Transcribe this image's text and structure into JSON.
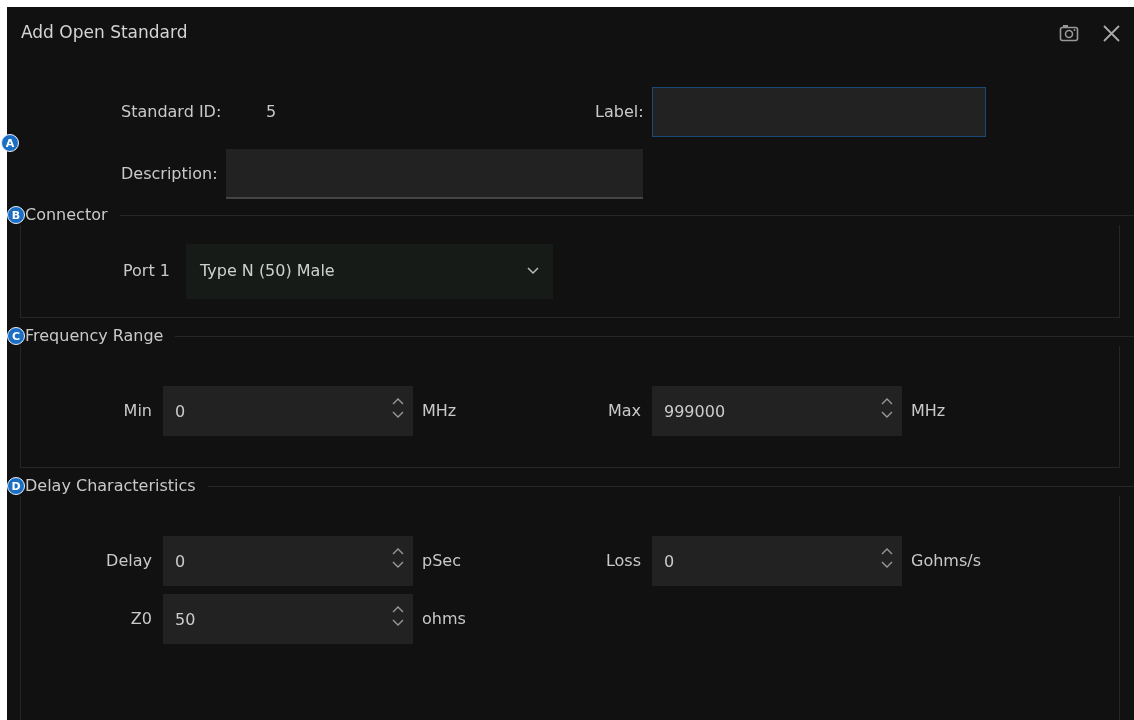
{
  "window": {
    "title": "Add Open Standard"
  },
  "identity": {
    "badge": "A",
    "standard_id_label": "Standard ID:",
    "standard_id_value": "5",
    "label_field": {
      "label": "Label:",
      "focused": true
    },
    "description_field": {
      "label": "Description:",
      "focused": false
    }
  },
  "connector": {
    "badge": "B",
    "title": "Connector",
    "port_label": "Port 1",
    "value": "Type N (50) Male"
  },
  "frequency_range": {
    "badge": "C",
    "title": "Frequency Range",
    "fields": [
      {
        "label": "Min",
        "value": "0",
        "unit": "MHz"
      },
      {
        "label": "Max",
        "value": "999000",
        "unit": "MHz"
      }
    ]
  },
  "delay_characteristics": {
    "badge": "D",
    "title": "Delay Characteristics",
    "fields": [
      {
        "label": "Delay",
        "value": "0",
        "unit": "pSec"
      },
      {
        "label": "Loss",
        "value": "0",
        "unit": "Gohms/s"
      },
      {
        "label": "Z0",
        "value": "50",
        "unit": "ohms"
      }
    ]
  }
}
